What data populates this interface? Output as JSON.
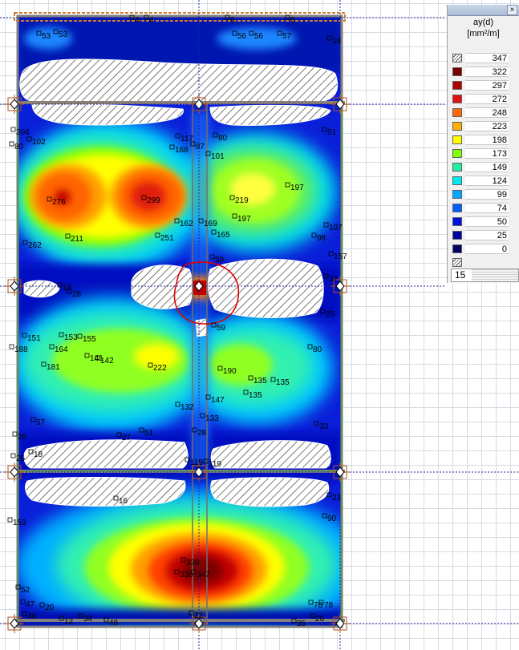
{
  "legend": {
    "title": "ay(d)",
    "unit": "[mm²/m]",
    "close_label": "×",
    "rows": [
      {
        "value": "347",
        "color": "#ffffff",
        "hatch": true
      },
      {
        "value": "322",
        "color": "#7a0000"
      },
      {
        "value": "297",
        "color": "#b00000"
      },
      {
        "value": "272",
        "color": "#e01010"
      },
      {
        "value": "248",
        "color": "#ff6a00"
      },
      {
        "value": "223",
        "color": "#ffb000"
      },
      {
        "value": "198",
        "color": "#ffff00"
      },
      {
        "value": "173",
        "color": "#80ff00"
      },
      {
        "value": "149",
        "color": "#20f0a0"
      },
      {
        "value": "124",
        "color": "#00e8f0"
      },
      {
        "value": "99",
        "color": "#00a8ff"
      },
      {
        "value": "74",
        "color": "#0060ff"
      },
      {
        "value": "50",
        "color": "#0010e0"
      },
      {
        "value": "25",
        "color": "#0000a0"
      },
      {
        "value": "0",
        "color": "#000060"
      },
      {
        "value": "",
        "color": "#ffffff",
        "hatch": true
      }
    ],
    "step_value": "15"
  },
  "slab": {
    "labels": [
      {
        "t": "4"
      },
      {
        "t": "4"
      },
      {
        "t": "6"
      },
      {
        "t": "6"
      },
      {
        "t": "53"
      },
      {
        "t": "53"
      },
      {
        "t": "56"
      },
      {
        "t": "56"
      },
      {
        "t": "57"
      },
      {
        "t": "18"
      },
      {
        "t": "204"
      },
      {
        "t": "102"
      },
      {
        "t": "80"
      },
      {
        "t": "117"
      },
      {
        "t": "168"
      },
      {
        "t": "87"
      },
      {
        "t": "80"
      },
      {
        "t": "101"
      },
      {
        "t": "51"
      },
      {
        "t": "276"
      },
      {
        "t": "299"
      },
      {
        "t": "219"
      },
      {
        "t": "197"
      },
      {
        "t": "262"
      },
      {
        "t": "211"
      },
      {
        "t": "251"
      },
      {
        "t": "162"
      },
      {
        "t": "169"
      },
      {
        "t": "197"
      },
      {
        "t": "165"
      },
      {
        "t": "98"
      },
      {
        "t": "107"
      },
      {
        "t": "157"
      },
      {
        "t": "59"
      },
      {
        "t": "18"
      },
      {
        "t": "28"
      },
      {
        "t": "37"
      },
      {
        "t": "25"
      },
      {
        "t": "59"
      },
      {
        "t": "151"
      },
      {
        "t": "153"
      },
      {
        "t": "155"
      },
      {
        "t": "164"
      },
      {
        "t": "188"
      },
      {
        "t": "141"
      },
      {
        "t": "142"
      },
      {
        "t": "181"
      },
      {
        "t": "222"
      },
      {
        "t": "190"
      },
      {
        "t": "80"
      },
      {
        "t": "135"
      },
      {
        "t": "135"
      },
      {
        "t": "135"
      },
      {
        "t": "147"
      },
      {
        "t": "132"
      },
      {
        "t": "133"
      },
      {
        "t": "57"
      },
      {
        "t": "27"
      },
      {
        "t": "51"
      },
      {
        "t": "28"
      },
      {
        "t": "33"
      },
      {
        "t": "28"
      },
      {
        "t": "26"
      },
      {
        "t": "18"
      },
      {
        "t": "119"
      },
      {
        "t": "119"
      },
      {
        "t": "16"
      },
      {
        "t": "23"
      },
      {
        "t": "153"
      },
      {
        "t": "90"
      },
      {
        "t": "339"
      },
      {
        "t": "336"
      },
      {
        "t": "347"
      },
      {
        "t": "52"
      },
      {
        "t": "47"
      },
      {
        "t": "20"
      },
      {
        "t": "46"
      },
      {
        "t": "12"
      },
      {
        "t": "34"
      },
      {
        "t": "48"
      },
      {
        "t": "22"
      },
      {
        "t": "78"
      },
      {
        "t": "78"
      },
      {
        "t": "26"
      },
      {
        "t": "35"
      }
    ]
  }
}
